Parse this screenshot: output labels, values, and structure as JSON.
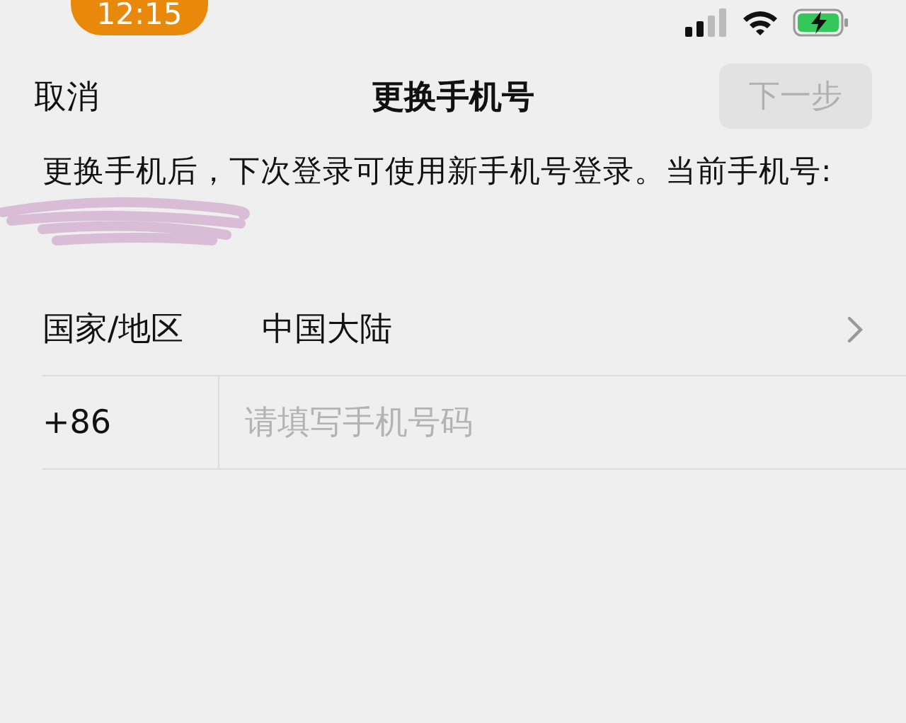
{
  "status_bar": {
    "time": "12:15"
  },
  "nav": {
    "cancel": "取消",
    "title": "更换手机号",
    "next": {
      "label": "下一步",
      "disabled": true
    }
  },
  "notice": "更换手机后，下次登录可使用新手机号登录。当前手机号:",
  "form": {
    "region": {
      "label": "国家/地区",
      "value": "中国大陆"
    },
    "phone": {
      "code": "+86",
      "placeholder": "请填写手机号码"
    }
  }
}
